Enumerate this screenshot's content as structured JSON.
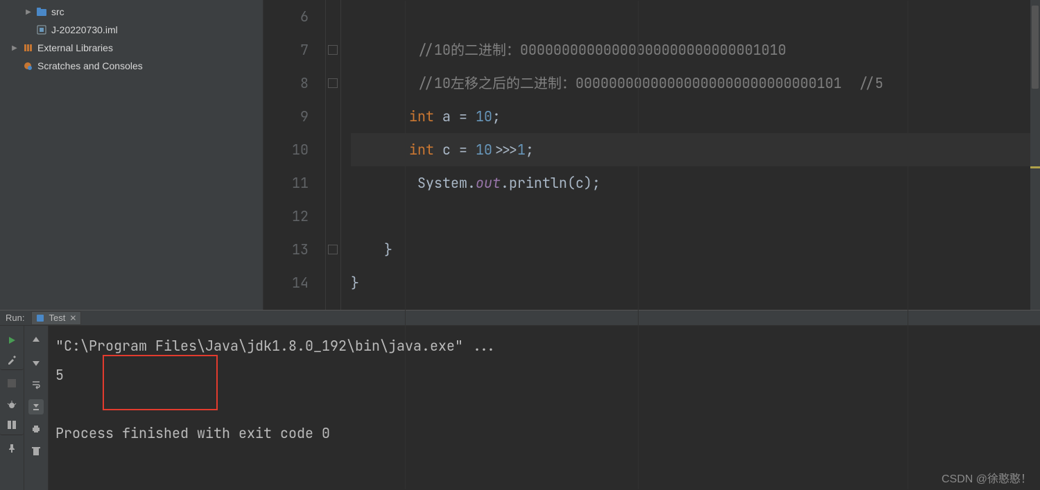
{
  "projectTree": {
    "src": {
      "label": "src"
    },
    "iml": {
      "label": "J-20220730.iml"
    },
    "external": {
      "label": "External Libraries"
    },
    "scratches": {
      "label": "Scratches and Consoles"
    }
  },
  "editor": {
    "currentLine": 10,
    "lines": [
      {
        "n": 6,
        "kind": "blank",
        "text": ""
      },
      {
        "n": 7,
        "kind": "comment",
        "indent": "        ",
        "text": "//10的二进制：00000000000000000000000000001010"
      },
      {
        "n": 8,
        "kind": "comment",
        "indent": "        ",
        "text": "//10左移之后的二进制：00000000000000000000000000000101  //5"
      },
      {
        "n": 9,
        "kind": "decl",
        "indent": "       ",
        "kw": "int",
        "name": " a = ",
        "num": "10",
        "tail": ";"
      },
      {
        "n": 10,
        "kind": "decl2",
        "indent": "       ",
        "kw": "int",
        "name": " c = ",
        "num": "10",
        "mid": ">>>",
        "num2": "1",
        "tail": ";"
      },
      {
        "n": 11,
        "kind": "println",
        "indent": "        ",
        "pre": "System.",
        "fld": "out",
        "post": ".println(c);"
      },
      {
        "n": 12,
        "kind": "blank",
        "text": ""
      },
      {
        "n": 13,
        "kind": "plain",
        "text": "    }"
      },
      {
        "n": 14,
        "kind": "plain",
        "text": "}"
      }
    ]
  },
  "run": {
    "panelLabel": "Run:",
    "tabName": "Test",
    "console": {
      "cmd": "\"C:\\Program Files\\Java\\jdk1.8.0_192\\bin\\java.exe\" ...",
      "output": "5",
      "exitMsg": "Process finished with exit code 0"
    }
  },
  "watermark": "CSDN @徐憨憨！"
}
